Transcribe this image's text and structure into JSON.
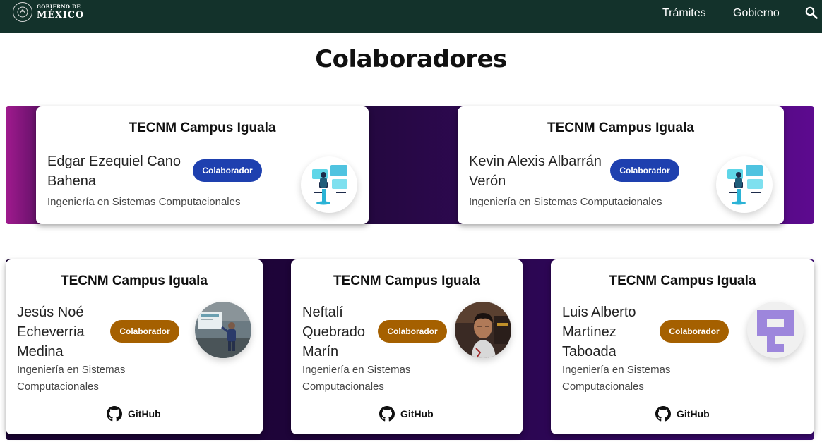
{
  "header": {
    "logo_line1": "GOBIERNO DE",
    "logo_line2": "MÉXICO",
    "nav": [
      {
        "label": "Trámites"
      },
      {
        "label": "Gobierno"
      }
    ]
  },
  "page": {
    "title": "Colaboradores"
  },
  "cards": [
    {
      "campus": "TECNM Campus Iguala",
      "name": "Edgar Ezequiel Cano Bahena",
      "role": "Colaborador",
      "career": "Ingeniería en Sistemas Computacionales",
      "avatar": "developer-illustration"
    },
    {
      "campus": "TECNM Campus Iguala",
      "name": "Kevin Alexis Albarrán Verón",
      "role": "Colaborador",
      "career": "Ingeniería en Sistemas Computacionales",
      "avatar": "developer-illustration"
    },
    {
      "campus": "TECNM Campus Iguala",
      "name": "Jesús Noé Echeverria Medina",
      "role": "Colaborador",
      "career": "Ingeniería en Sistemas Computacionales",
      "link": "GitHub",
      "avatar": "photo-presenter"
    },
    {
      "campus": "TECNM Campus Iguala",
      "name": "Neftalí Quebrado Marín",
      "role": "Colaborador",
      "career": "Ingeniería en Sistemas Computacionales",
      "link": "GitHub",
      "avatar": "photo-portrait"
    },
    {
      "campus": "TECNM Campus Iguala",
      "name": "Luis Alberto Martinez Taboada",
      "role": "Colaborador",
      "career": "Ingeniería en Sistemas Computacionales",
      "link": "GitHub",
      "avatar": "identicon"
    }
  ],
  "colors": {
    "nav_bg": "#13322b",
    "badge_top": "#1e40af",
    "badge_bottom": "#a56000",
    "identicon": "#9d86dc"
  }
}
